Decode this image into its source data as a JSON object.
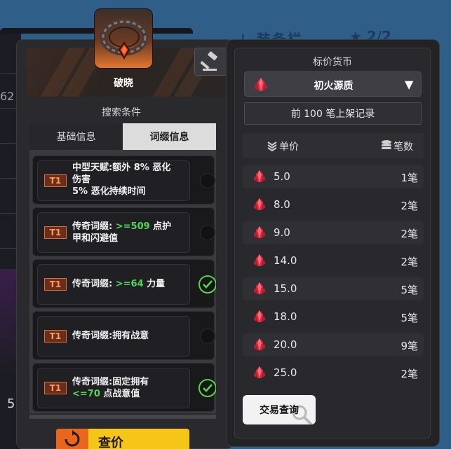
{
  "background": {
    "top_text": "↓ 装备栏",
    "rating": "★ 2/2",
    "left_number": "62",
    "bottom_number": "5"
  },
  "item": {
    "name": "破晓",
    "icon": "ring-icon"
  },
  "search": {
    "label": "搜索条件",
    "tabs": [
      {
        "label": "基础信息",
        "active": false
      },
      {
        "label": "词缀信息",
        "active": true
      }
    ]
  },
  "affixes": [
    {
      "tier": "T1",
      "lines": [
        "中型天赋:额外 8% 恶化",
        "伤害",
        "5% 恶化持续时间"
      ],
      "selected": false
    },
    {
      "tier": "T1",
      "prefix": "传奇词缀: ",
      "highlight": ">=509",
      "suffix": " 点护",
      "line2": "甲和闪避值",
      "selected": false
    },
    {
      "tier": "T1",
      "prefix": "传奇词缀: ",
      "highlight": ">=64",
      "suffix": " 力量",
      "selected": true
    },
    {
      "tier": "T1",
      "text": "传奇词缀:拥有战意",
      "selected": false
    },
    {
      "tier": "T1",
      "line1": "传奇词缀:固定拥有",
      "highlight": "<=70",
      "suffix": " 点战意值",
      "selected": true
    }
  ],
  "price_button": {
    "label": "查价"
  },
  "currency": {
    "label": "标价货币",
    "selected": "初火源质"
  },
  "records_button": "前 100 笔上架记录",
  "columns": {
    "price": "单价",
    "count": "笔数"
  },
  "listings": [
    {
      "price": "5.0",
      "count": "1笔"
    },
    {
      "price": "8.0",
      "count": "2笔"
    },
    {
      "price": "9.0",
      "count": "2笔"
    },
    {
      "price": "14.0",
      "count": "2笔"
    },
    {
      "price": "15.0",
      "count": "5笔"
    },
    {
      "price": "18.0",
      "count": "5笔"
    },
    {
      "price": "20.0",
      "count": "9笔"
    },
    {
      "price": "25.0",
      "count": "2笔"
    }
  ],
  "trade_button": "交易查询",
  "colors": {
    "accent_orange": "#e8661e",
    "accent_yellow": "#f5c518",
    "tier_orange": "#ff9b5e",
    "highlight_green": "#4fd65a",
    "gem_red": "#d62a40"
  }
}
